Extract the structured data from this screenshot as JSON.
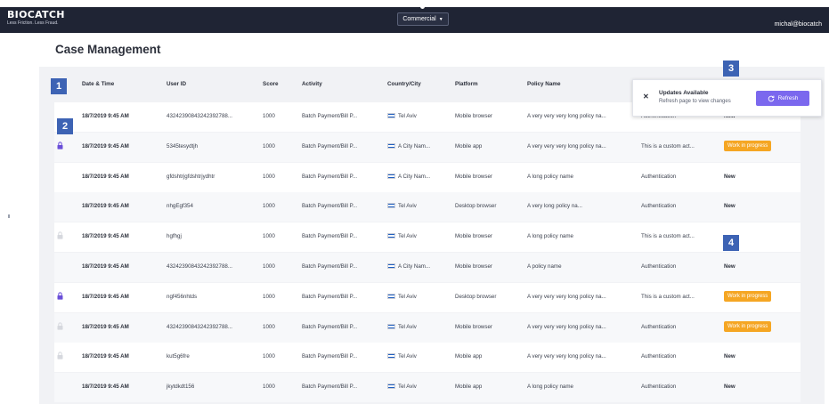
{
  "header": {
    "logo_text": "BIOCATCH",
    "logo_tagline": "Less Friction. Less Fraud.",
    "environment": "Commercial",
    "user": "michal@biocatch"
  },
  "page": {
    "title": "Case Management"
  },
  "table": {
    "columns": [
      "Date & Time",
      "User ID",
      "Score",
      "Activity",
      "Country/City",
      "Platform",
      "Policy Name"
    ],
    "rows": [
      {
        "date": "18/7/2019 9:45 AM",
        "user_id": "43242390843242392788...",
        "score": "1000",
        "activity": "Batch Payment/Bill P...",
        "city": "Tel Aviv",
        "platform": "Mobile browser",
        "policy": "A very very very long policy na...",
        "rule": "Authentication",
        "status": "New",
        "status_type": "new",
        "lock": "none"
      },
      {
        "date": "18/7/2019 9:45 AM",
        "user_id": "5345tesydtjh",
        "score": "1000",
        "activity": "Batch Payment/Bill P...",
        "city": "A City Nam...",
        "platform": "Mobile app",
        "policy": "A very very very long policy na...",
        "rule": "This is a custom act...",
        "status": "Work in progress",
        "status_type": "wip",
        "lock": "locked"
      },
      {
        "date": "18/7/2019 9:45 AM",
        "user_id": "gfdshtrjgfdshtrjydhtr",
        "score": "1000",
        "activity": "Batch Payment/Bill P...",
        "city": "A City Nam...",
        "platform": "Mobile browser",
        "policy": "A long policy name",
        "rule": "Authentication",
        "status": "New",
        "status_type": "new",
        "lock": "none"
      },
      {
        "date": "18/7/2019 9:45 AM",
        "user_id": "nhgEgf354",
        "score": "1000",
        "activity": "Batch Payment/Bill P...",
        "city": "Tel Aviv",
        "platform": "Desktop browser",
        "policy": "A very long policy na...",
        "rule": "Authentication",
        "status": "New",
        "status_type": "new",
        "lock": "none"
      },
      {
        "date": "18/7/2019 9:45 AM",
        "user_id": "hgfhgj",
        "score": "1000",
        "activity": "Batch Payment/Bill P...",
        "city": "Tel Aviv",
        "platform": "Mobile browser",
        "policy": "A long policy name",
        "rule": "This is a custom act...",
        "status": "",
        "status_type": "none",
        "lock": "faded"
      },
      {
        "date": "18/7/2019 9:45 AM",
        "user_id": "43242390843242392788...",
        "score": "1000",
        "activity": "Batch Payment/Bill P...",
        "city": "A City Nam...",
        "platform": "Mobile browser",
        "policy": "A policy name",
        "rule": "Authentication",
        "status": "New",
        "status_type": "new",
        "lock": "none"
      },
      {
        "date": "18/7/2019 9:45 AM",
        "user_id": "ngf456nhtds",
        "score": "1000",
        "activity": "Batch Payment/Bill P...",
        "city": "Tel Aviv",
        "platform": "Desktop browser",
        "policy": "A very very very long policy na...",
        "rule": "This is a custom act...",
        "status": "Work in progress",
        "status_type": "wip",
        "lock": "locked"
      },
      {
        "date": "18/7/2019 9:45 AM",
        "user_id": "43242390843242392788...",
        "score": "1000",
        "activity": "Batch Payment/Bill P...",
        "city": "Tel Aviv",
        "platform": "Mobile browser",
        "policy": "A very very very long policy na...",
        "rule": "Authentication",
        "status": "Work in progress",
        "status_type": "wip",
        "lock": "faded"
      },
      {
        "date": "18/7/2019 9:45 AM",
        "user_id": "kut5g6fre",
        "score": "1000",
        "activity": "Batch Payment/Bill P...",
        "city": "Tel Aviv",
        "platform": "Mobile app",
        "policy": "A very very very long policy na...",
        "rule": "Authentication",
        "status": "New",
        "status_type": "new",
        "lock": "faded"
      },
      {
        "date": "18/7/2019 9:45 AM",
        "user_id": "jkytdkdt156",
        "score": "1000",
        "activity": "Batch Payment/Bill P...",
        "city": "Tel Aviv",
        "platform": "Mobile app",
        "policy": "A long policy name",
        "rule": "Authentication",
        "status": "New",
        "status_type": "new",
        "lock": "none"
      }
    ]
  },
  "toast": {
    "title": "Updates Available",
    "body": "Refresh page to view changes",
    "button": "Refresh"
  },
  "markers": [
    "1",
    "2",
    "3",
    "4"
  ],
  "colors": {
    "topbar": "#1f2434",
    "accent_button": "#7b68ee",
    "wip_badge": "#f5a623",
    "marker": "#3d63b4",
    "lock_active": "#6a4fd8",
    "lock_faded": "#d6d8de"
  },
  "icons": {
    "lock": "lock-icon",
    "flag": "israel-flag-icon",
    "close": "close-icon",
    "refresh": "refresh-icon",
    "dropdown": "chevron-down-icon"
  }
}
